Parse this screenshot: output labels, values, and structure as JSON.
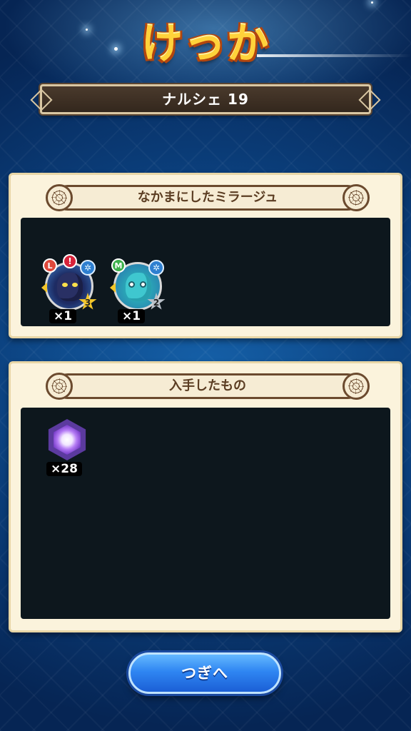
{
  "title": "けっか",
  "stage": {
    "label": "ナルシェ 19"
  },
  "recruited": {
    "header": "なかまにしたミラージュ",
    "items": [
      {
        "icon": "dark-wolf-mirage-icon",
        "rank": "L",
        "stars": "3",
        "element": "✲",
        "count": "×1"
      },
      {
        "icon": "blue-frog-mirage-icon",
        "rank": "M",
        "stars": "2",
        "element": "✲",
        "count": "×1"
      }
    ]
  },
  "obtained": {
    "header": "入手したもの",
    "items": [
      {
        "icon": "purple-crystal-icon",
        "count": "×28"
      }
    ]
  },
  "next_button": {
    "label": "つぎへ"
  },
  "colors": {
    "panel": "#fbf3dc",
    "panel_body": "#0d171d",
    "button": "#2f86f2",
    "title": "#ffd23a"
  }
}
